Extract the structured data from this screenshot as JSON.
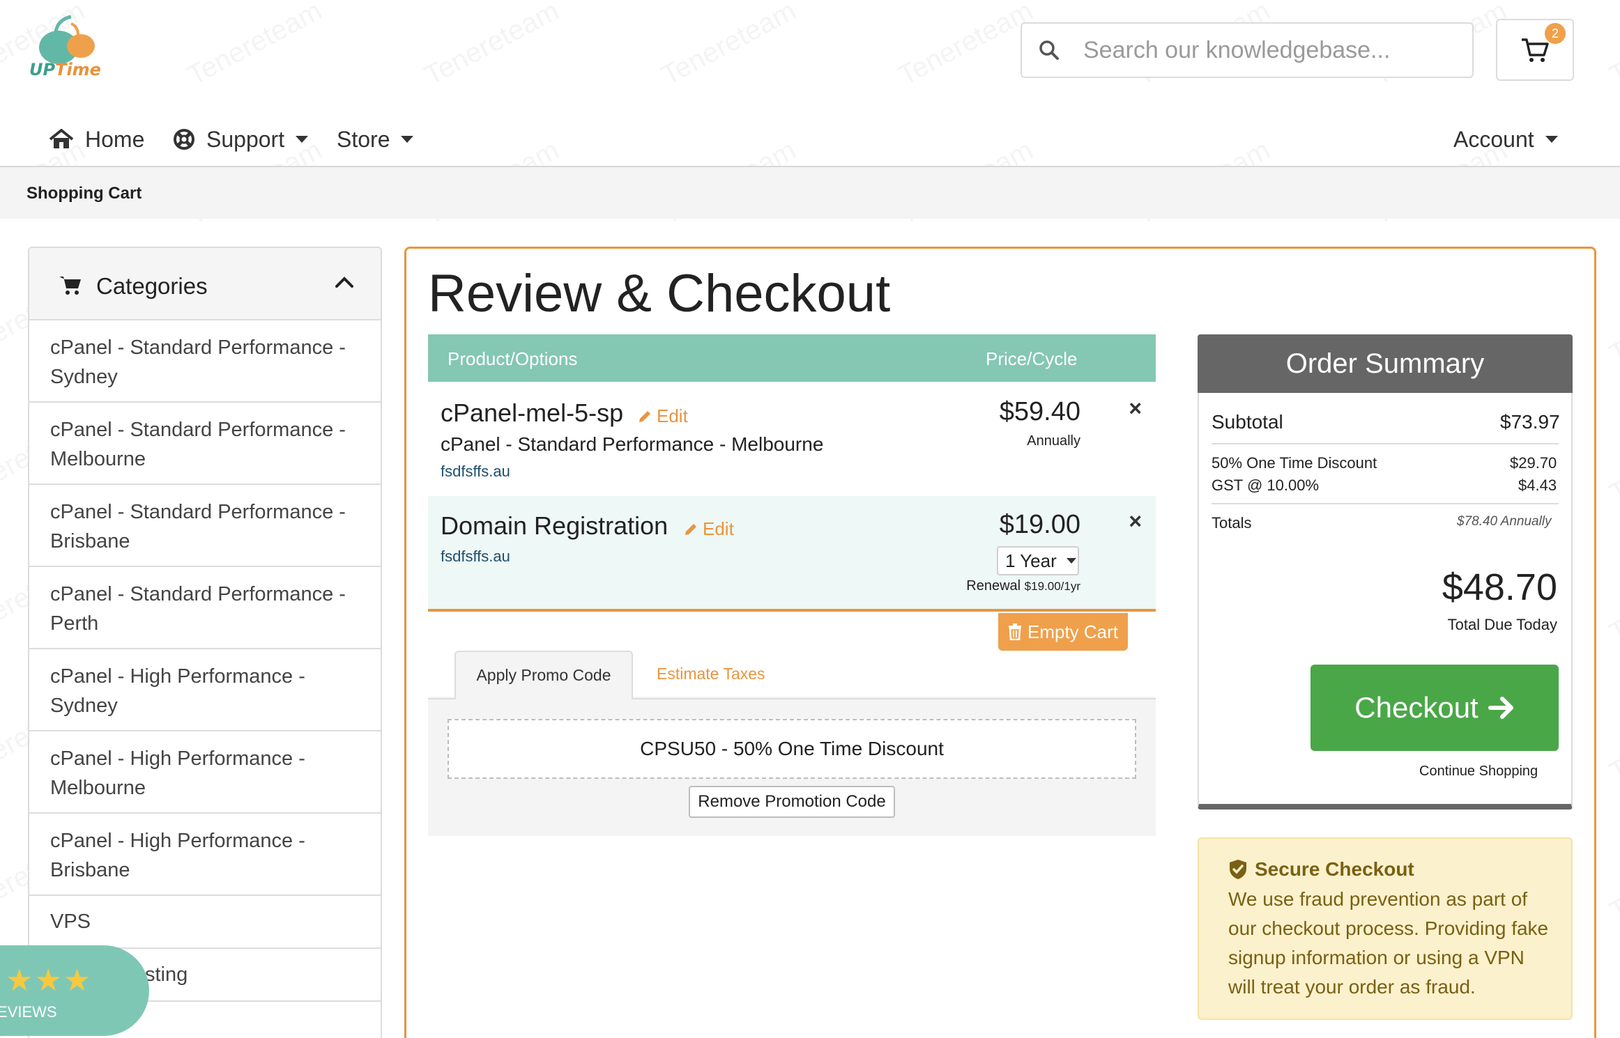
{
  "brand": {
    "logo_part1": "UP",
    "logo_part2": "Time"
  },
  "header": {
    "search_placeholder": "Search our knowledgebase...",
    "cart_count": "2"
  },
  "nav": {
    "home": "Home",
    "support": "Support",
    "store": "Store",
    "account": "Account"
  },
  "breadcrumb": "Shopping Cart",
  "sidebar": {
    "title": "Categories",
    "items": [
      {
        "label": "cPanel - Standard Performance - Sydney"
      },
      {
        "label": "cPanel - Standard Performance - Melbourne"
      },
      {
        "label": "cPanel - Standard Performance - Brisbane"
      },
      {
        "label": "cPanel - Standard Performance - Perth"
      },
      {
        "label": "cPanel - High Performance - Sydney"
      },
      {
        "label": "cPanel - High Performance - Melbourne"
      },
      {
        "label": "cPanel - High Performance - Brisbane"
      },
      {
        "label": "VPS"
      },
      {
        "label": "sting"
      }
    ]
  },
  "reviews_badge": {
    "stars": "★★★",
    "label": "EVIEWS"
  },
  "page_title": "Review & Checkout",
  "cart_table": {
    "col_product": "Product/Options",
    "col_price": "Price/Cycle",
    "items": [
      {
        "name": "cPanel-mel-5-sp",
        "edit": "Edit",
        "description": "cPanel - Standard Performance - Melbourne",
        "domain": "fsdfsffs.au",
        "price": "$59.40",
        "cycle": "Annually",
        "remove": "×"
      },
      {
        "name": "Domain Registration",
        "edit": "Edit",
        "domain": "fsdfsffs.au",
        "price": "$19.00",
        "period": "1 Year",
        "renewal_label": "Renewal",
        "renewal_value": "$19.00/1yr",
        "remove": "×"
      }
    ],
    "empty_cart": "Empty Cart"
  },
  "promo": {
    "tab_active": "Apply Promo Code",
    "tab_other": "Estimate Taxes",
    "applied_code": "CPSU50 - 50% One Time Discount",
    "remove_button": "Remove Promotion Code"
  },
  "order_summary": {
    "title": "Order Summary",
    "subtotal_label": "Subtotal",
    "subtotal_value": "$73.97",
    "discount_label": "50% One Time Discount",
    "discount_value": "$29.70",
    "tax_label": "GST @ 10.00%",
    "tax_value": "$4.43",
    "totals_label": "Totals",
    "totals_value": "$78.40 Annually",
    "total_due": "$48.70",
    "total_due_label": "Total Due Today",
    "checkout_button": "Checkout",
    "continue_link": "Continue Shopping"
  },
  "secure_checkout": {
    "title": "Secure Checkout",
    "body": "We use fraud prevention as part of our checkout process. Providing fake signup information or using a VPN will treat your order as fraud."
  },
  "colors": {
    "accent_orange": "#e8953f",
    "table_header_teal": "#84c7b3",
    "checkout_green": "#4aa748",
    "summary_header_gray": "#666666",
    "secure_bg": "#fbf1cc"
  }
}
